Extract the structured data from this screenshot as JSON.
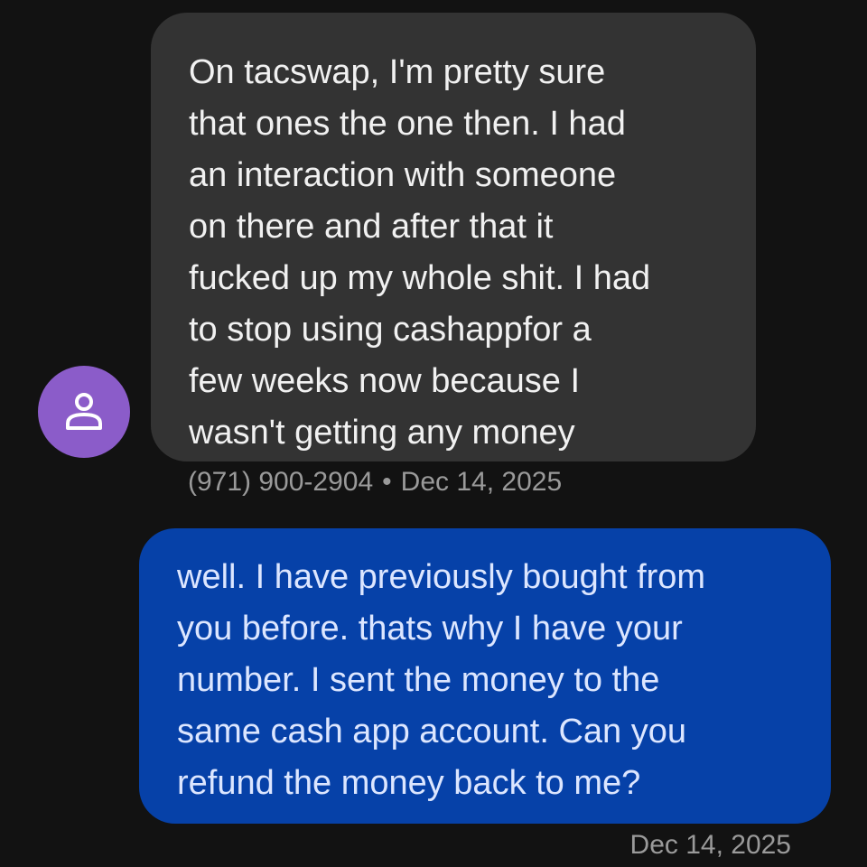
{
  "incoming_message": {
    "text": "On tacswap, I'm pretty sure\nthat ones the one then. I had\nan interaction with someone\non there and after that it\nfucked up my whole shit. I had\nto stop using cashappfor a\nfew weeks now because I\nwasn't getting any money",
    "sender": "(971) 900-2904",
    "separator": "•",
    "date": "Dec 14, 2025",
    "avatar_icon": "person-icon",
    "avatar_color": "#8b5cc9",
    "bubble_color": "#333333"
  },
  "outgoing_message": {
    "text": "well. I have previously bought from\nyou before. thats why I have your\nnumber. I sent the money to the\nsame cash app account. Can you\nrefund the money back to me?",
    "date": "Dec 14, 2025",
    "bubble_color": "#0641a8"
  }
}
